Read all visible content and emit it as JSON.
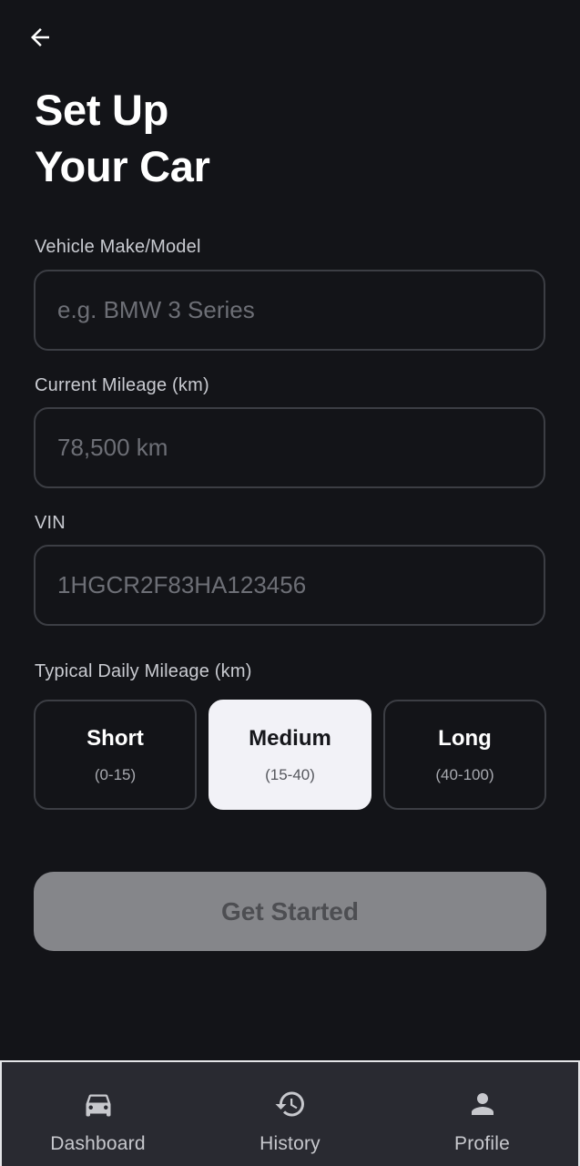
{
  "header": {
    "back_icon": "arrow-left-icon",
    "title_line1": "Set Up",
    "title_line2": "Your Car"
  },
  "form": {
    "make_model": {
      "label": "Vehicle Make/Model",
      "placeholder": "e.g. BMW 3 Series",
      "value": ""
    },
    "mileage": {
      "label": "Current Mileage (km)",
      "placeholder": "78,500 km",
      "value": ""
    },
    "vin": {
      "label": "VIN",
      "placeholder": "1HGCR2F83HA123456",
      "value": ""
    },
    "daily_mileage": {
      "label": "Typical Daily Mileage (km)",
      "selected": "Medium",
      "options": [
        {
          "title": "Short",
          "range": "(0-15)"
        },
        {
          "title": "Medium",
          "range": "(15-40)"
        },
        {
          "title": "Long",
          "range": "(40-100)"
        }
      ]
    },
    "submit_label": "Get Started"
  },
  "nav": {
    "items": [
      {
        "label": "Dashboard",
        "icon": "car-icon"
      },
      {
        "label": "History",
        "icon": "history-icon"
      },
      {
        "label": "Profile",
        "icon": "person-icon"
      }
    ]
  },
  "colors": {
    "background": "#131418",
    "selected_option": "#f2f2f7",
    "button_disabled": "#85868a",
    "nav_background": "#292a31"
  }
}
